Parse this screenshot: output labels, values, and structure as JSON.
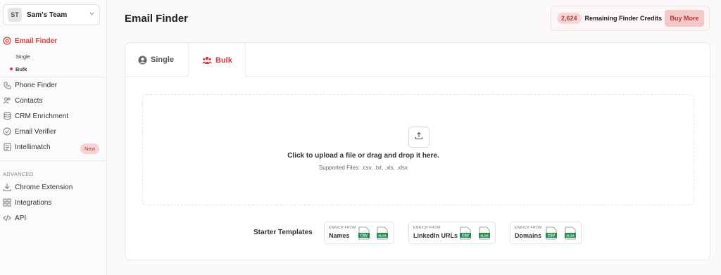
{
  "team": {
    "initials": "ST",
    "name": "Sam's Team"
  },
  "sidebar": {
    "email_finder": "Email Finder",
    "sub_single": "Single",
    "sub_bulk": "Bulk",
    "items": [
      {
        "label": "Phone Finder",
        "icon": "phone-icon"
      },
      {
        "label": "Contacts",
        "icon": "contacts-icon"
      },
      {
        "label": "CRM Enrichment",
        "icon": "database-icon"
      },
      {
        "label": "Email Verifier",
        "icon": "check-circle-icon"
      },
      {
        "label": "Intellimatch",
        "icon": "intellimatch-icon"
      }
    ],
    "new_badge": "New",
    "section_label": "ADVANCED",
    "advanced": [
      {
        "label": "Chrome Extension",
        "icon": "download-icon"
      },
      {
        "label": "Integrations",
        "icon": "grid-icon"
      },
      {
        "label": "API",
        "icon": "code-icon"
      }
    ]
  },
  "header": {
    "title": "Email Finder",
    "credits_count": "2,624",
    "credits_label": "Remaining Finder Credits",
    "buy_label": "Buy More"
  },
  "tabs": [
    {
      "label": "Single"
    },
    {
      "label": "Bulk"
    }
  ],
  "upload": {
    "title": "Click to upload a file or drag and drop it here.",
    "supported": "Supported Files: .csv, .txt, .xls, .xlsx"
  },
  "starter": {
    "label": "Starter Templates",
    "enrich_from": "ENRICH FROM",
    "templates": [
      {
        "name": "Names",
        "csv": "CSV",
        "xlsx": "XLSX"
      },
      {
        "name": "LinkedIn URLs",
        "csv": "CSV",
        "xlsx": "XLSX"
      },
      {
        "name": "Domains",
        "csv": "CSV",
        "xlsx": "XLSX"
      }
    ]
  },
  "colors": {
    "accent": "#d63a3a",
    "file_green": "#1f8f4e"
  }
}
